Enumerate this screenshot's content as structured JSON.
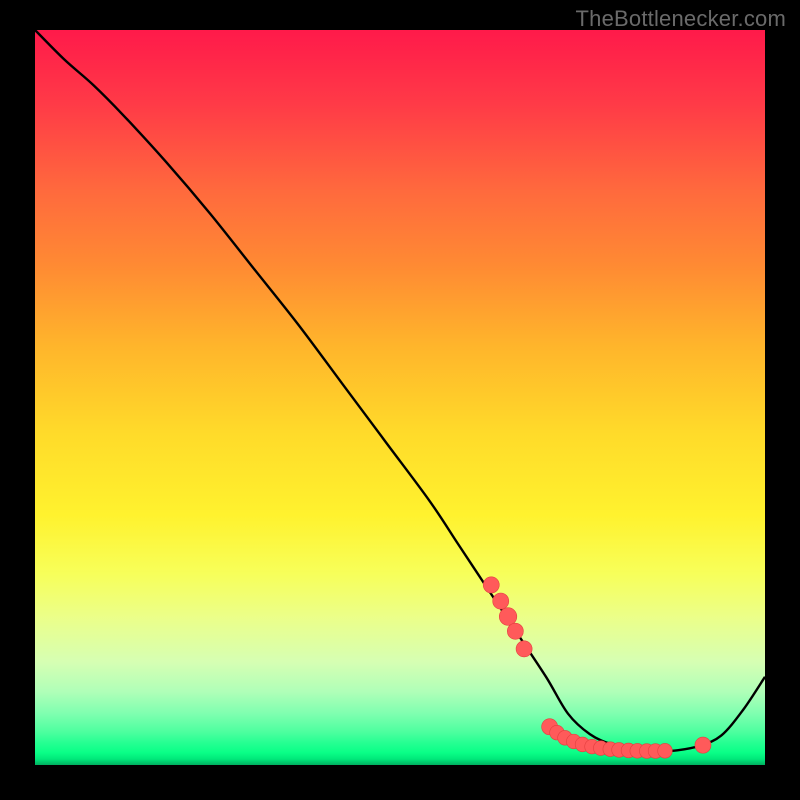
{
  "watermark": "TheBottlenecker.com",
  "colors": {
    "background": "#000000",
    "curve": "#000000",
    "marker_fill": "#ff5a5a",
    "marker_stroke": "#e43f3f",
    "gradient_top": "#ff1a4a",
    "gradient_bottom": "#00b060"
  },
  "chart_data": {
    "type": "line",
    "title": "",
    "xlabel": "",
    "ylabel": "",
    "xlim": [
      0,
      100
    ],
    "ylim": [
      0,
      100
    ],
    "grid": false,
    "legend": false,
    "notes": "Bottleneck-style curve: y≈100 at x=0, falls along a near-straight diagonal, flattens to a minimum near y≈2 around x≈73–90, then rises toward y≈12 at x=100. Red markers sit on/near the curve in the flat valley.",
    "series": [
      {
        "name": "curve",
        "x": [
          0,
          4,
          8,
          12,
          18,
          24,
          30,
          36,
          42,
          48,
          54,
          58,
          62,
          66,
          70,
          73,
          76,
          79,
          82,
          85,
          88,
          91,
          94,
          97,
          100
        ],
        "y": [
          100,
          96,
          92.5,
          88.5,
          82,
          75,
          67.5,
          60,
          52,
          44,
          36,
          30,
          24,
          18,
          12,
          7,
          4.2,
          2.8,
          2.1,
          1.9,
          2.0,
          2.6,
          4.0,
          7.5,
          12
        ]
      }
    ],
    "markers": [
      {
        "x": 62.5,
        "y": 24.5,
        "r": 1.1
      },
      {
        "x": 63.8,
        "y": 22.3,
        "r": 1.1
      },
      {
        "x": 64.8,
        "y": 20.2,
        "r": 1.2
      },
      {
        "x": 65.8,
        "y": 18.2,
        "r": 1.1
      },
      {
        "x": 67.0,
        "y": 15.8,
        "r": 1.1
      },
      {
        "x": 70.5,
        "y": 5.2,
        "r": 1.1
      },
      {
        "x": 71.5,
        "y": 4.4,
        "r": 1.0
      },
      {
        "x": 72.6,
        "y": 3.7,
        "r": 1.0
      },
      {
        "x": 73.8,
        "y": 3.2,
        "r": 1.0
      },
      {
        "x": 75.0,
        "y": 2.8,
        "r": 1.0
      },
      {
        "x": 76.3,
        "y": 2.5,
        "r": 1.0
      },
      {
        "x": 77.5,
        "y": 2.3,
        "r": 1.0
      },
      {
        "x": 78.8,
        "y": 2.15,
        "r": 1.0
      },
      {
        "x": 80.0,
        "y": 2.05,
        "r": 1.0
      },
      {
        "x": 81.3,
        "y": 1.98,
        "r": 1.0
      },
      {
        "x": 82.5,
        "y": 1.93,
        "r": 1.0
      },
      {
        "x": 83.8,
        "y": 1.9,
        "r": 1.0
      },
      {
        "x": 85.0,
        "y": 1.9,
        "r": 1.0
      },
      {
        "x": 86.3,
        "y": 1.93,
        "r": 1.0
      },
      {
        "x": 91.5,
        "y": 2.7,
        "r": 1.1
      }
    ]
  }
}
